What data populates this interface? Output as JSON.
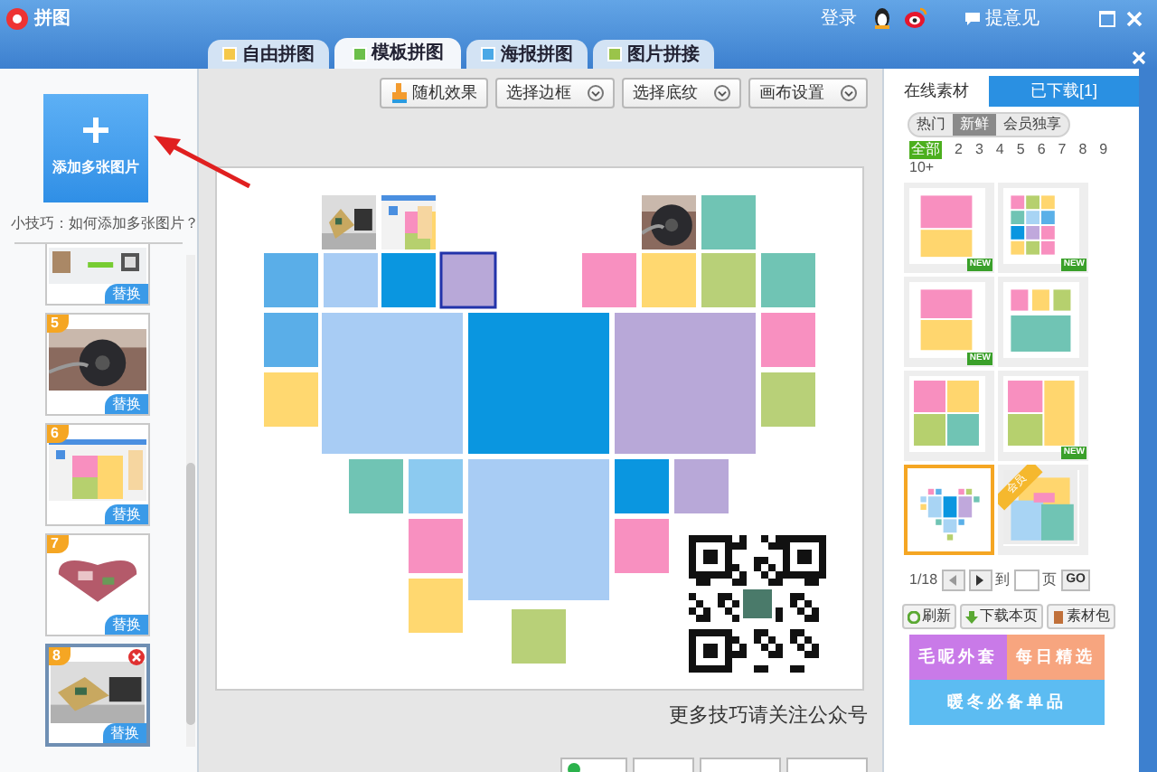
{
  "window": {
    "title": "拼图"
  },
  "header": {
    "login": "登录",
    "feedback": "提意见"
  },
  "tabs": [
    {
      "label": "自由拼图",
      "selected": false
    },
    {
      "label": "模板拼图",
      "selected": true
    },
    {
      "label": "海报拼图",
      "selected": false
    },
    {
      "label": "图片拼接",
      "selected": false
    }
  ],
  "left_panel": {
    "add_button": "添加多张图片",
    "tip": "小技巧：如何添加多张图片？",
    "thumbnails": [
      {
        "replace": "替换",
        "selected": false
      },
      {
        "number": "5",
        "replace": "替换",
        "selected": false
      },
      {
        "number": "6",
        "replace": "替换",
        "selected": false
      },
      {
        "number": "7",
        "replace": "替换",
        "selected": false
      },
      {
        "number": "8",
        "replace": "替换",
        "selected": true
      }
    ]
  },
  "toolbar": [
    {
      "label": "随机效果",
      "kind": "action"
    },
    {
      "label": "选择边框",
      "kind": "dropdown"
    },
    {
      "label": "选择底纹",
      "kind": "dropdown"
    },
    {
      "label": "画布设置",
      "kind": "dropdown"
    }
  ],
  "canvas": {
    "footer": "更多技巧请关注公众号"
  },
  "right_panel": {
    "tabs": [
      {
        "label": "在线素材",
        "selected": true
      },
      {
        "label": "已下载[1]",
        "selected": false
      }
    ],
    "filters": [
      {
        "label": "热门",
        "selected": false
      },
      {
        "label": "新鲜",
        "selected": true
      },
      {
        "label": "会员独享",
        "selected": false
      }
    ],
    "counts": [
      {
        "label": "全部",
        "selected": true
      },
      {
        "label": "2",
        "selected": false
      },
      {
        "label": "3",
        "selected": false
      },
      {
        "label": "4",
        "selected": false
      },
      {
        "label": "5",
        "selected": false
      },
      {
        "label": "6",
        "selected": false
      },
      {
        "label": "7",
        "selected": false
      },
      {
        "label": "8",
        "selected": false
      },
      {
        "label": "9",
        "selected": false
      },
      {
        "label": "10+",
        "selected": false
      }
    ],
    "templates": [
      {
        "badge": {
          "kind": "new",
          "text": "NEW"
        },
        "selected": false
      },
      {
        "badge": {
          "kind": "new",
          "text": "NEW"
        },
        "selected": false
      },
      {
        "badge": {
          "kind": "new",
          "text": "NEW"
        },
        "selected": false
      },
      {
        "selected": false
      },
      {
        "selected": false
      },
      {
        "badge": {
          "kind": "new",
          "text": "NEW"
        },
        "selected": false
      },
      {
        "selected": true
      },
      {
        "badge": {
          "kind": "ribbon",
          "text": "会员"
        },
        "selected": false
      }
    ],
    "pager": {
      "page": "1/18",
      "goto": "到",
      "unit": "页",
      "go": "GO"
    },
    "actions": [
      "刷新",
      "下载本页",
      "素材包"
    ],
    "banners": [
      {
        "text": "毛呢外套",
        "color": "#c97ae8"
      },
      {
        "text": "每日精选",
        "color": "#f7a57f"
      },
      {
        "text": "暖冬必备单品",
        "color": "#5cbcf2"
      }
    ]
  }
}
